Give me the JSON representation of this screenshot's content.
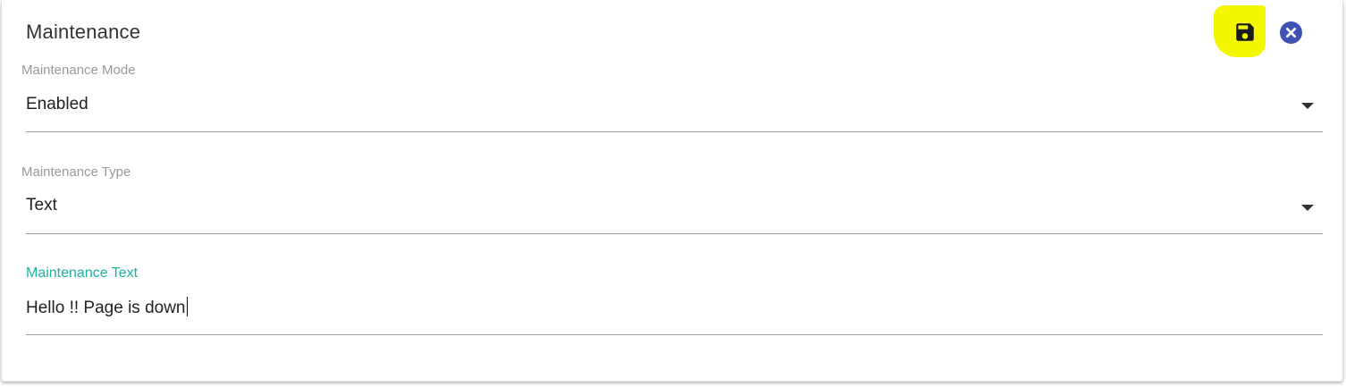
{
  "header": {
    "title": "Maintenance"
  },
  "actions": {
    "save": {
      "icon": "save-icon",
      "highlight_color": "#f3f700"
    },
    "close": {
      "icon": "close-circle-icon",
      "color": "#3f51b5"
    }
  },
  "fields": {
    "mode": {
      "label": "Maintenance Mode",
      "value": "Enabled"
    },
    "type": {
      "label": "Maintenance Type",
      "value": "Text"
    },
    "text": {
      "label": "Maintenance Text",
      "value": "Hello !! Page is down",
      "label_color": "#1fb3a3"
    }
  }
}
